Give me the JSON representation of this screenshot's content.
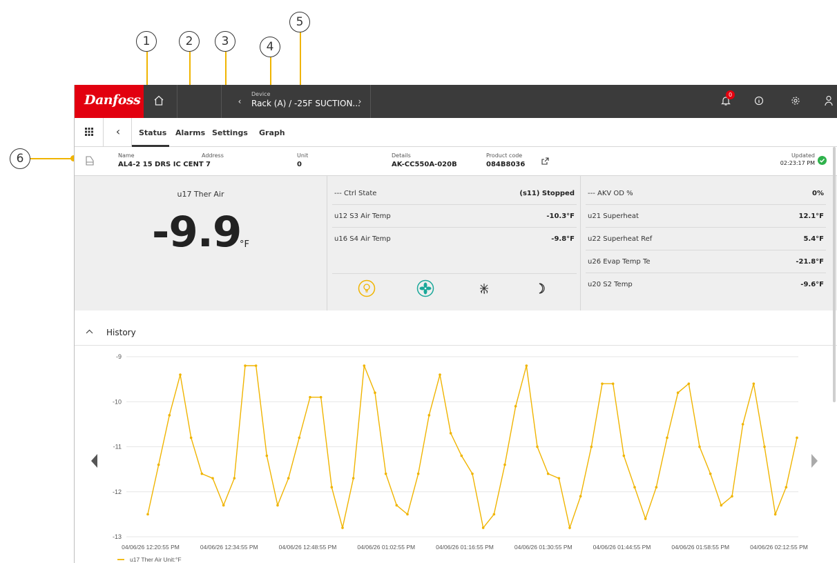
{
  "callouts": [
    "1",
    "2",
    "3",
    "4",
    "5",
    "6"
  ],
  "topbar": {
    "logo_text": "Danfoss",
    "home_icon": "home-icon",
    "device_label": "Device",
    "device_value": "Rack (A) / -25F SUCTION...",
    "alarm_count": "0",
    "colors": {
      "bar": "#3b3b3b",
      "logo": "#e2000f",
      "badge": "#e2000f"
    }
  },
  "tabs": [
    {
      "label": "Status",
      "active": true
    },
    {
      "label": "Alarms",
      "active": false
    },
    {
      "label": "Settings",
      "active": false
    },
    {
      "label": "Graph",
      "active": false
    }
  ],
  "info": {
    "name_label": "Name",
    "name_value": "AL4-2 15 DRS IC CENT",
    "address_label": "Address",
    "address_value": "7",
    "unit_label": "Unit",
    "unit_value": "0",
    "details_label": "Details",
    "details_value": "AK-CC550A-020B",
    "product_label": "Product code",
    "product_value": "084B8036",
    "updated_label": "Updated",
    "updated_value": "02:23:17 PM"
  },
  "status": {
    "big_label": "u17 Ther Air",
    "big_value": "-9.9",
    "big_unit": "°F",
    "middle": [
      {
        "label": "--- Ctrl State",
        "value": "(s11) Stopped"
      },
      {
        "label": "u12 S3 Air Temp",
        "value": "-10.3°F"
      },
      {
        "label": "u16 S4 Air Temp",
        "value": "-9.8°F"
      }
    ],
    "right": [
      {
        "label": "--- AKV OD %",
        "value": "0%"
      },
      {
        "label": "u21 Superheat",
        "value": "12.1°F"
      },
      {
        "label": "u22 Superheat Ref",
        "value": "5.4°F"
      },
      {
        "label": "u26 Evap Temp Te",
        "value": "-21.8°F"
      },
      {
        "label": "u20 S2 Temp",
        "value": "-9.6°F"
      }
    ],
    "icons": [
      "light-bulb-icon",
      "fan-icon",
      "defrost-icon",
      "night-mode-icon"
    ],
    "icon_colors": {
      "light": "#f0b400",
      "fan": "#1aa89a",
      "defrost": "#333333",
      "night": "#333333"
    }
  },
  "history": {
    "title": "History"
  },
  "chart_data": {
    "type": "line",
    "ylim": [
      -13,
      -9
    ],
    "yticks": [
      "-9",
      "-10",
      "-11",
      "-12",
      "-13"
    ],
    "xticks": [
      "04/06/26 12:20:55 PM",
      "04/06/26 12:34:55 PM",
      "04/06/26 12:48:55 PM",
      "04/06/26 01:02:55 PM",
      "04/06/26 01:16:55 PM",
      "04/06/26 01:30:55 PM",
      "04/06/26 01:44:55 PM",
      "04/06/26 01:58:55 PM",
      "04/06/26 02:12:55 PM"
    ],
    "series": [
      {
        "name": "u17 Ther Air Unit:°F",
        "color": "#f0b400",
        "values": [
          -12.5,
          -11.4,
          -10.3,
          -9.4,
          -10.8,
          -11.6,
          -11.7,
          -12.3,
          -11.7,
          -9.2,
          -9.2,
          -11.2,
          -12.3,
          -11.7,
          -10.8,
          -9.9,
          -9.9,
          -11.9,
          -12.8,
          -11.7,
          -9.2,
          -9.8,
          -11.6,
          -12.3,
          -12.5,
          -11.6,
          -10.3,
          -9.4,
          -10.7,
          -11.2,
          -11.6,
          -12.8,
          -12.5,
          -11.4,
          -10.1,
          -9.2,
          -11.0,
          -11.6,
          -11.7,
          -12.8,
          -12.1,
          -11.0,
          -9.6,
          -9.6,
          -11.2,
          -11.9,
          -12.6,
          -11.9,
          -10.8,
          -9.8,
          -9.6,
          -11.0,
          -11.6,
          -12.3,
          -12.1,
          -10.5,
          -9.6,
          -11.0,
          -12.5,
          -11.9,
          -10.8
        ]
      }
    ],
    "legend": "bottom-left",
    "grid": true
  }
}
